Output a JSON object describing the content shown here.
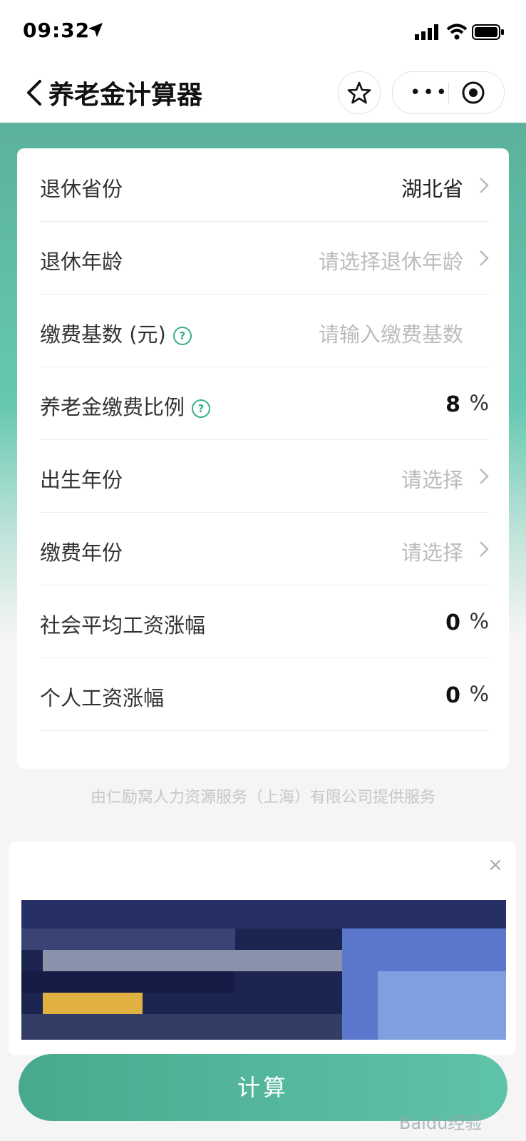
{
  "status_bar": {
    "time": "09:32"
  },
  "nav": {
    "title": "养老金计算器",
    "icons": [
      "back-icon",
      "star-icon",
      "more-icon",
      "record-icon"
    ]
  },
  "form": {
    "rows": [
      {
        "label": "退休省份",
        "value": "湖北省"
      },
      {
        "label": "退休年龄",
        "placeholder": "请选择退休年龄"
      },
      {
        "label": "缴费基数 (元)",
        "placeholder": "请输入缴费基数"
      },
      {
        "label": "养老金缴费比例",
        "value": "8",
        "unit": "%"
      },
      {
        "label": "出生年份",
        "placeholder": "请选择"
      },
      {
        "label": "缴费年份",
        "placeholder": "请选择"
      },
      {
        "label": "社会平均工资涨幅",
        "value": "0",
        "unit": "%"
      },
      {
        "label": "个人工资涨幅",
        "value": "0",
        "unit": "%"
      }
    ]
  },
  "provider_text": "由仁励窝人力资源服务（上海）有限公司提供服务",
  "ad": {
    "close": "×"
  },
  "calculate_label": "计算",
  "watermark": "Baidu经验"
}
